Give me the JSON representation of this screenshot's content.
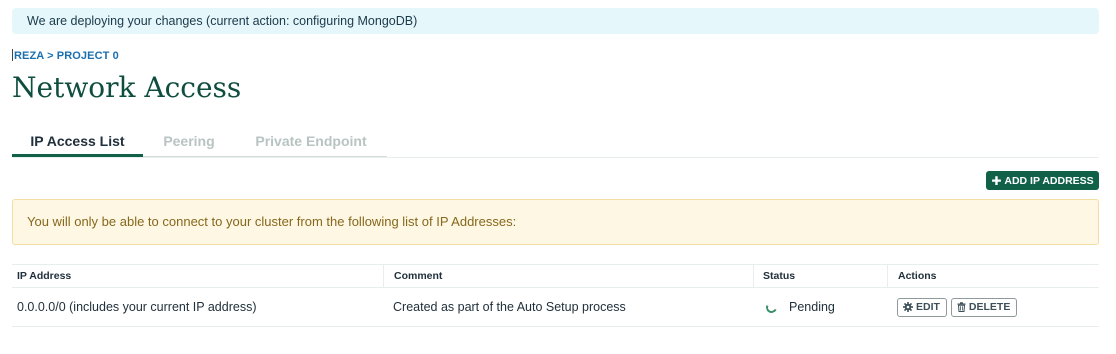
{
  "banner": {
    "text": "We are deploying your changes (current action: configuring MongoDB)"
  },
  "breadcrumb": {
    "text": "REZA > PROJECT 0"
  },
  "page_title": "Network Access",
  "tabs": [
    {
      "label": "IP Access List",
      "active": true
    },
    {
      "label": "Peering",
      "active": false
    },
    {
      "label": "Private Endpoint",
      "active": false
    }
  ],
  "add_button": {
    "icon": "plus-icon",
    "label": "ADD IP ADDRESS"
  },
  "notice": {
    "text": "You will only be able to connect to your cluster from the following list of IP Addresses:"
  },
  "table": {
    "headers": {
      "ip": "IP Address",
      "comment": "Comment",
      "status": "Status",
      "actions": "Actions"
    },
    "rows": [
      {
        "ip": "0.0.0.0/0  (includes your current IP address)",
        "comment": "Created as part of the Auto Setup process",
        "status": "Pending",
        "edit_label": "EDIT",
        "delete_label": "DELETE"
      }
    ]
  },
  "colors": {
    "accent": "#116149",
    "banner_bg": "#e6f7fc",
    "notice_bg": "#fef7e3",
    "title": "#0f4d3f"
  }
}
